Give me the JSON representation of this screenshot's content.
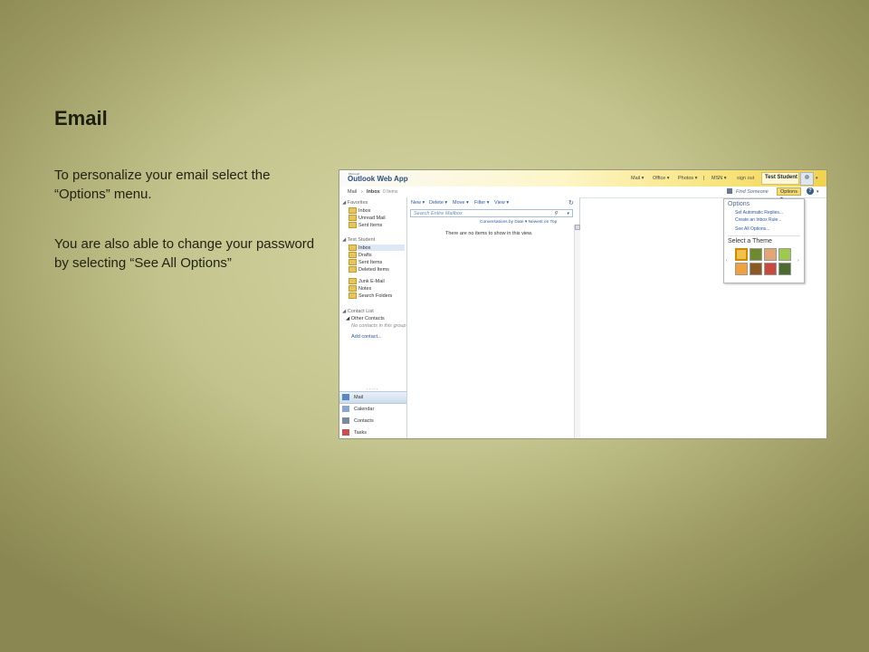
{
  "slide": {
    "title": "Email",
    "paragraphs": [
      "To personalize your email select the “Options” menu.",
      "You are also able to change your password by selecting “See All Options”"
    ]
  },
  "owa": {
    "logo_small": "Microsoft",
    "logo": "Outlook Web App",
    "topnav": [
      "Mail ▾",
      "Office ▾",
      "Photos ▾",
      "|",
      "MSN ▾"
    ],
    "sign_out": "sign out",
    "user": "Test Student",
    "breadcrumb": [
      "Mail",
      "›",
      "Inbox",
      "0 Items"
    ],
    "find_someone": "Find Someone",
    "options_button": "Options ▾",
    "help": "?",
    "nav": {
      "favorites_header": "◢ Favorites",
      "favorites": [
        "Inbox",
        "Unread Mail",
        "Sent Items"
      ],
      "account_header": "◢ Test Student",
      "folders": [
        "Inbox",
        "Drafts",
        "Sent Items",
        "Deleted Items",
        "Junk E-Mail",
        "Notes",
        "Search Folders"
      ],
      "contacts_header": "◢ Contact List",
      "other_contacts": "◢ Other Contacts",
      "no_contacts": "No contacts in this group",
      "add_contact": "Add contact...",
      "dots": ".....",
      "wunderbar": [
        "Mail",
        "Calendar",
        "Contacts",
        "Tasks"
      ]
    },
    "toolbar": [
      "New ▾",
      "Delete ▾",
      "Move ▾",
      "Filter ▾",
      "View ▾"
    ],
    "search_placeholder": "Search Entire Mailbox",
    "conversations": "Conversations by Date ▾   Newest on Top",
    "empty_message": "There are no items to show in this view.",
    "options_menu": {
      "title": "Options",
      "items": [
        "Set Automatic Replies...",
        "Create an Inbox Rule...",
        "See All Options..."
      ],
      "theme_title": "Select a Theme"
    },
    "colors": {
      "accent": "#f2d24e",
      "link": "#2b5aa0"
    }
  }
}
